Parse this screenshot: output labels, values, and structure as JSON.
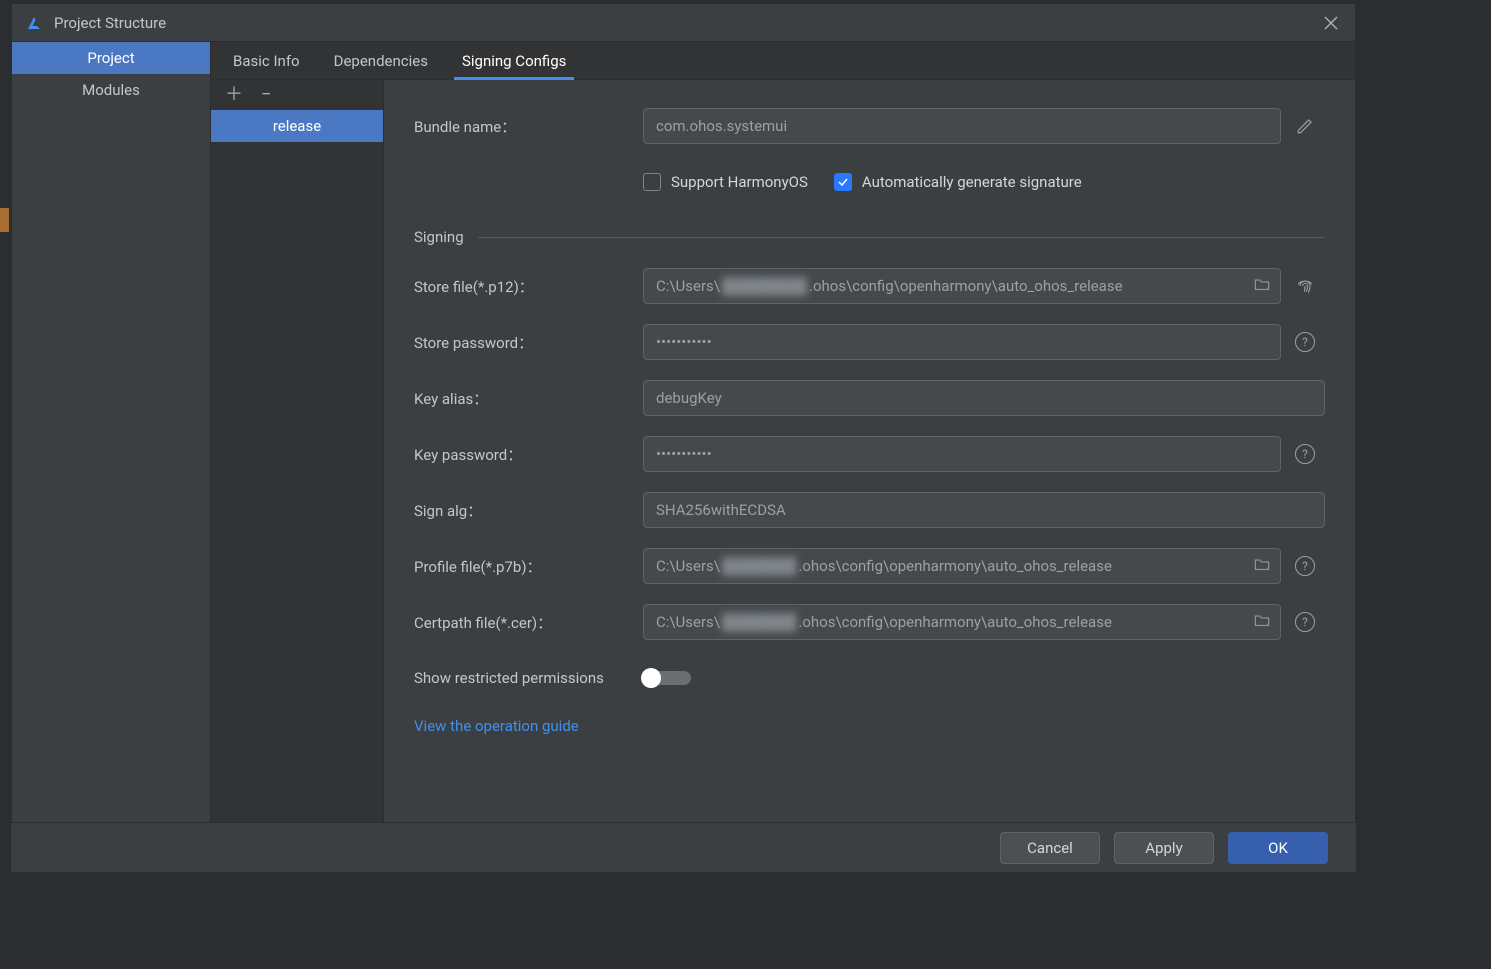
{
  "window": {
    "title": "Project Structure"
  },
  "nav": {
    "items": [
      "Project",
      "Modules"
    ],
    "active_index": 0
  },
  "tabs": {
    "items": [
      "Basic Info",
      "Dependencies",
      "Signing Configs"
    ],
    "active_index": 2
  },
  "configs": {
    "items": [
      "release"
    ],
    "active_index": 0
  },
  "form": {
    "bundle_name": {
      "label": "Bundle name：",
      "value": "com.ohos.systemui"
    },
    "support_harmony": {
      "label": "Support HarmonyOS",
      "checked": false
    },
    "auto_gen": {
      "label": "Automatically generate signature",
      "checked": true
    },
    "signing_header": "Signing",
    "store_file": {
      "label": "Store file(*.p12)：",
      "prefix": "C:\\Users\\",
      "suffix": ".ohos\\config\\openharmony\\auto_ohos_release"
    },
    "store_password": {
      "label": "Store password：",
      "value": "•••••••••••"
    },
    "key_alias": {
      "label": "Key alias：",
      "value": "debugKey"
    },
    "key_password": {
      "label": "Key password：",
      "value": "•••••••••••"
    },
    "sign_alg": {
      "label": "Sign alg：",
      "value": "SHA256withECDSA"
    },
    "profile_file": {
      "label": "Profile file(*.p7b)：",
      "prefix": "C:\\Users\\",
      "suffix": ".ohos\\config\\openharmony\\auto_ohos_release"
    },
    "certpath_file": {
      "label": "Certpath file(*.cer)：",
      "prefix": "C:\\Users\\",
      "suffix": ".ohos\\config\\openharmony\\auto_ohos_release"
    },
    "show_restricted": {
      "label": "Show restricted permissions",
      "on": false
    },
    "guide_link": "View the operation guide"
  },
  "buttons": {
    "cancel": "Cancel",
    "apply": "Apply",
    "ok": "OK"
  }
}
